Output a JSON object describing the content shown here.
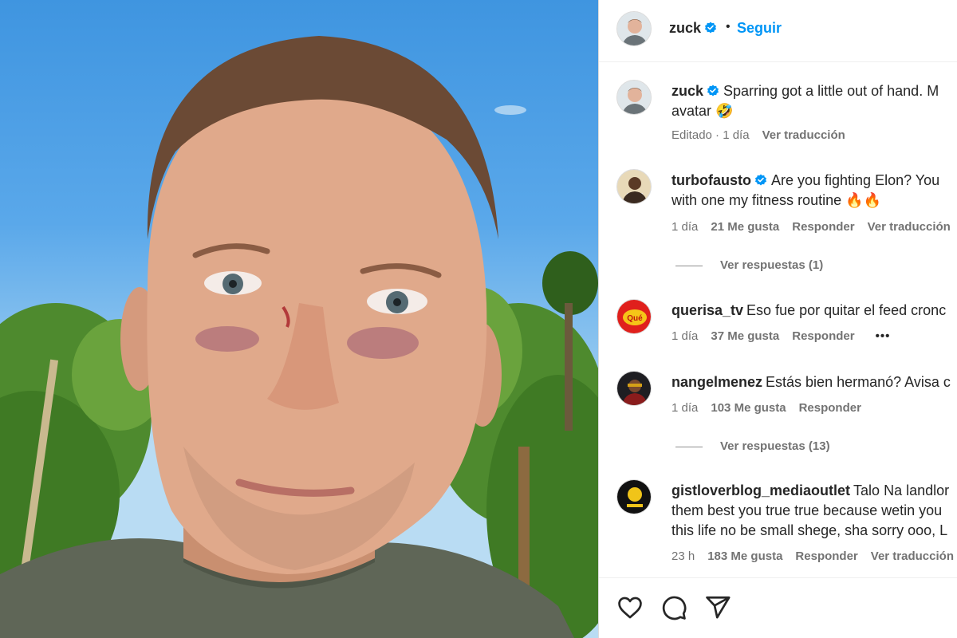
{
  "post": {
    "author": "zuck",
    "separator": "•",
    "follow_label": "Seguir"
  },
  "caption": {
    "username": "zuck",
    "text": "Sparring got a little out of hand. M",
    "text_line2": "avatar 🤣",
    "edited": "Editado",
    "time_sep": " · 1 día",
    "translate": "Ver traducción"
  },
  "comments": [
    {
      "username": "turbofausto",
      "verified": true,
      "line1": "Are you fighting Elon? You",
      "line2": "with one my fitness routine 🔥🔥",
      "time": "1 día",
      "likes": "21 Me gusta",
      "reply": "Responder",
      "translate": "Ver traducción",
      "replies": "Ver respuestas (1)"
    },
    {
      "username": "querisa_tv",
      "line1": "Eso fue por quitar el feed cronc",
      "time": "1 día",
      "likes": "37 Me gusta",
      "reply": "Responder",
      "more": "•••"
    },
    {
      "username": "nangelmenez",
      "line1": "Estás bien hermanó? Avisa c",
      "time": "1 día",
      "likes": "103 Me gusta",
      "reply": "Responder",
      "replies": "Ver respuestas (13)"
    },
    {
      "username": "gistloverblog_mediaoutlet",
      "line1": "Talo Na landlor",
      "line2": "them best you true true because wetin you",
      "line3": "this life no be small shege, sha sorry ooo, L",
      "time": "23 h",
      "likes": "183 Me gusta",
      "reply": "Responder",
      "translate": "Ver traducción"
    }
  ],
  "icons": {
    "like": "heart-icon",
    "comment": "comment-icon",
    "share": "share-icon",
    "verified": "verified-badge-icon"
  },
  "colors": {
    "accent": "#0095f6",
    "verified": "#0095f6",
    "muted": "#737373"
  }
}
